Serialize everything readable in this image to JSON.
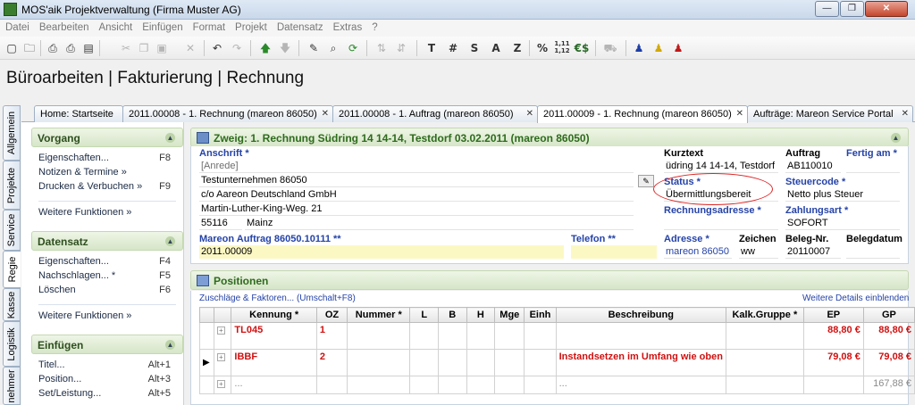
{
  "window": {
    "title": "MOS'aik Projektverwaltung (Firma Muster AG)",
    "minimize": "—",
    "maximize": "❐",
    "close": "✕"
  },
  "menu": [
    "Datei",
    "Bearbeiten",
    "Ansicht",
    "Einfügen",
    "Format",
    "Projekt",
    "Datensatz",
    "Extras",
    "?"
  ],
  "toolbar": {
    "format_buttons": [
      "T",
      "#",
      "S",
      "A",
      "Z",
      "%",
      "1,11\n1,12",
      "€$"
    ],
    "icons": [
      "new-icon",
      "open-icon",
      "print-preview-icon",
      "print-icon",
      "preview-icon",
      "cut-icon",
      "copy-icon",
      "paste-icon",
      "delete-icon",
      "undo-icon",
      "redo-icon",
      "arrow-up-icon",
      "arrow-down-icon",
      "edit-icon",
      "find-icon",
      "refresh-icon",
      "sort-icon",
      "user-blue-icon",
      "user-yellow-icon",
      "user-red-icon"
    ]
  },
  "page_title": "Büroarbeiten | Fakturierung | Rechnung",
  "vertical_tabs": [
    "Allgemein",
    "Projekte",
    "Service",
    "Regie",
    "Kasse",
    "Logistik",
    "nehmer"
  ],
  "doc_tabs": [
    {
      "label": "Home: Startseite"
    },
    {
      "label": "2011.00008 - 1. Rechnung (mareon 86050)"
    },
    {
      "label": "2011.00008 - 1. Auftrag (mareon 86050)"
    },
    {
      "label": "2011.00009 - 1. Rechnung (mareon 86050)"
    },
    {
      "label": "Aufträge: Mareon Service Portal"
    }
  ],
  "sidebar": {
    "vorgang": {
      "title": "Vorgang",
      "items": [
        {
          "label": "Eigenschaften...",
          "key": "F8"
        },
        {
          "label": "Notizen & Termine »",
          "key": ""
        },
        {
          "label": "Drucken & Verbuchen »",
          "key": "F9"
        }
      ],
      "more": "Weitere Funktionen »"
    },
    "datensatz": {
      "title": "Datensatz",
      "items": [
        {
          "label": "Eigenschaften...",
          "key": "F4"
        },
        {
          "label": "Nachschlagen... *",
          "key": "F5"
        },
        {
          "label": "Löschen",
          "key": "F6"
        }
      ],
      "more": "Weitere Funktionen »"
    },
    "einfuegen": {
      "title": "Einfügen",
      "items": [
        {
          "label": "Titel...",
          "key": "Alt+1"
        },
        {
          "label": "Position...",
          "key": "Alt+3"
        },
        {
          "label": "Set/Leistung...",
          "key": "Alt+5"
        }
      ]
    }
  },
  "zweig": {
    "header": "Zweig: 1. Rechnung Südring 14 14-14, Testdorf 03.02.2011 (mareon 86050)",
    "anschrift_label": "Anschrift *",
    "anrede": "[Anrede]",
    "name": "Testunternehmen 86050",
    "co": "c/o Aareon Deutschland GmbH",
    "street": "Martin-Luther-King-Weg. 21",
    "zip": "55116",
    "city": "Mainz",
    "kurztext_label": "Kurztext",
    "kurztext": "üdring 14 14-14, Testdorf",
    "auftrag_label": "Auftrag",
    "auftrag": "AB110010",
    "fertig_label": "Fertig am *",
    "fertig": "",
    "status_label": "Status *",
    "status": "Übermittlungsbereit",
    "steuercode_label": "Steuercode *",
    "steuercode": "Netto plus Steuer",
    "rechnungsadresse_label": "Rechnungsadresse *",
    "zahlungsart_label": "Zahlungsart *",
    "zahlungsart": "SOFORT",
    "mareon_label": "Mareon Auftrag 86050.10111 **",
    "mareon_value": "2011.00009",
    "telefon_label": "Telefon **",
    "telefon": "",
    "adresse_label": "Adresse *",
    "adresse": "mareon 86050",
    "zeichen_label": "Zeichen",
    "zeichen": "ww",
    "beleg_label": "Beleg-Nr.",
    "beleg": "20110007",
    "belegdatum_label": "Belegdatum",
    "belegdatum": ""
  },
  "positionen": {
    "header": "Positionen",
    "zuschlaege_link": "Zuschläge & Faktoren... (Umschalt+F8)",
    "details_link": "Weitere Details einblenden",
    "columns": [
      "Kennung *",
      "OZ",
      "Nummer *",
      "L",
      "B",
      "H",
      "Mge",
      "Einh",
      "Beschreibung",
      "Kalk.Gruppe *",
      "EP",
      "GP"
    ],
    "rows": [
      {
        "kennung": "TL045",
        "oz": "1",
        "beschreibung": "",
        "ep": "88,80 €",
        "gp": "88,80 €"
      },
      {
        "kennung": "IBBF",
        "oz": "2",
        "beschreibung": "Instandsetzen im Umfang wie oben",
        "ep": "79,08 €",
        "gp": "79,08 €"
      },
      {
        "kennung": "...",
        "oz": "",
        "beschreibung": "...",
        "ep": "",
        "gp": "167,88 €"
      }
    ]
  }
}
